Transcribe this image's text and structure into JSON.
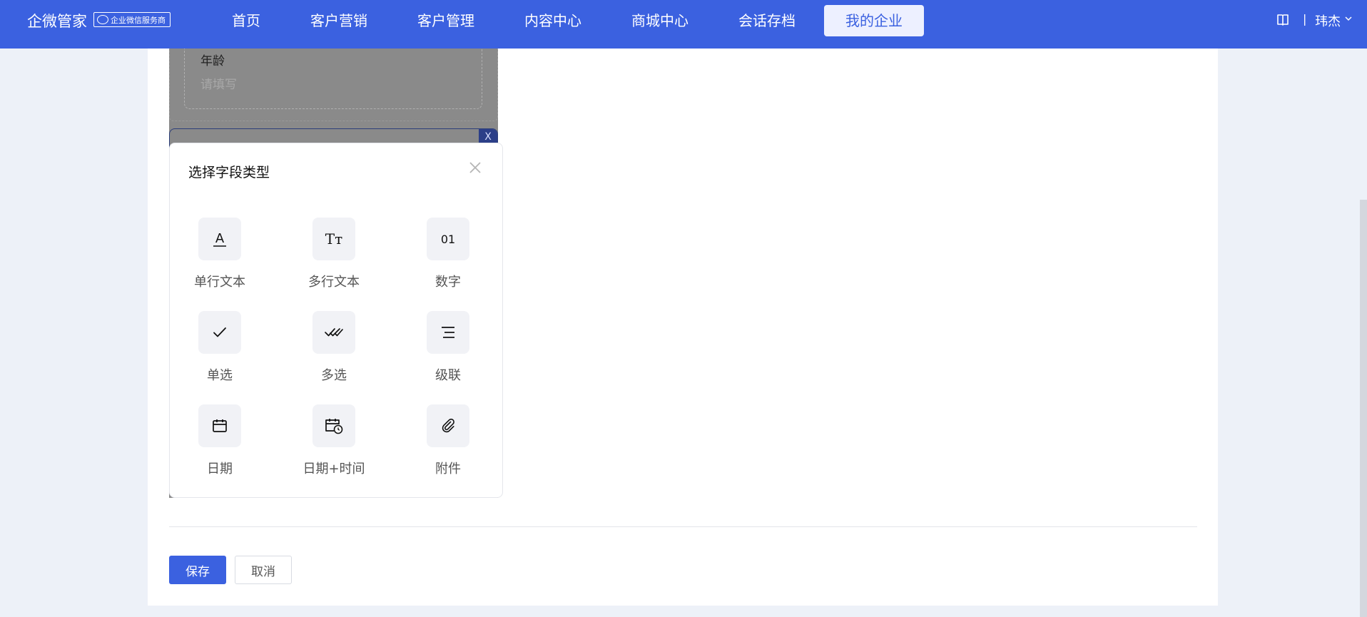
{
  "header": {
    "brand": "企微管家",
    "badge": "企业微信服务商",
    "nav": [
      "首页",
      "客户营销",
      "客户管理",
      "内容中心",
      "商城中心",
      "会话存档",
      "我的企业"
    ],
    "separator": "|",
    "user": "玮杰"
  },
  "form": {
    "age_label": "年龄",
    "age_placeholder": "请填写",
    "remove_label": "X"
  },
  "popup": {
    "title": "选择字段类型",
    "types": [
      {
        "label": "单行文本",
        "icon": "text-underline-icon"
      },
      {
        "label": "多行文本",
        "icon": "text-size-icon"
      },
      {
        "label": "数字",
        "icon": "number-icon"
      },
      {
        "label": "单选",
        "icon": "check-icon"
      },
      {
        "label": "多选",
        "icon": "double-check-icon"
      },
      {
        "label": "级联",
        "icon": "cascade-icon"
      },
      {
        "label": "日期",
        "icon": "calendar-icon"
      },
      {
        "label": "日期+时间",
        "icon": "calendar-clock-icon"
      },
      {
        "label": "附件",
        "icon": "paperclip-icon"
      }
    ],
    "glyph_a": "A",
    "glyph_tt": "Tт",
    "glyph_num": "01"
  },
  "actions": {
    "save": "保存",
    "cancel": "取消"
  },
  "colors": {
    "primary": "#3b61e0",
    "nav_active_bg": "#edf0ff"
  }
}
